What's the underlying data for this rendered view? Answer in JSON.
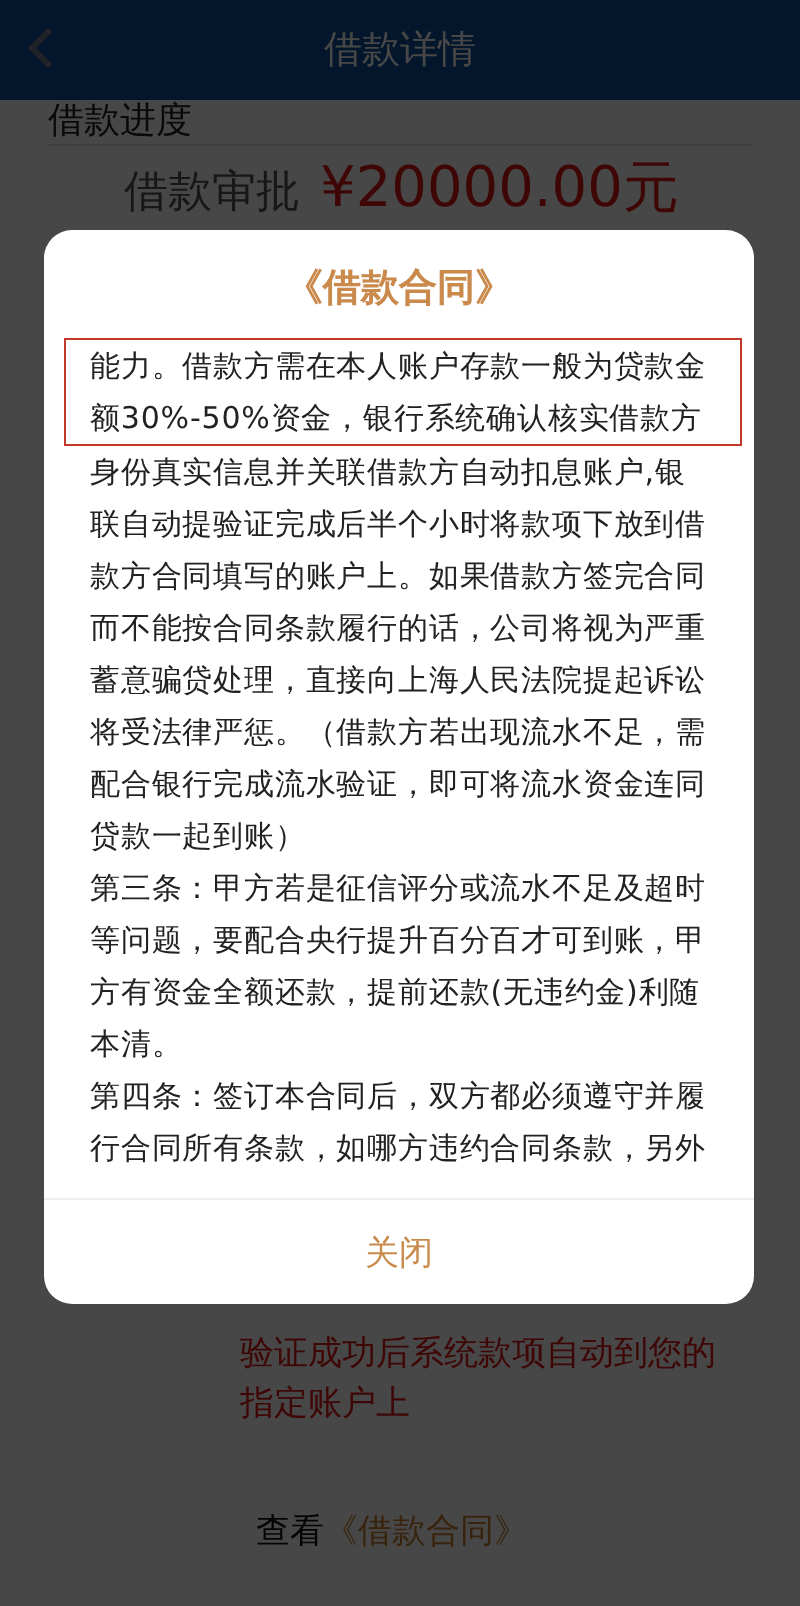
{
  "header": {
    "title": "借款详情"
  },
  "page": {
    "section_title": "借款进度",
    "approval_label": "借款审批",
    "amount": "¥20000.00元",
    "notice_lines": [
      "验证成功后系统款项自动到您的",
      "指定账户上"
    ],
    "contract_link": {
      "prefix": "查看",
      "link": "《借款合同》"
    }
  },
  "dialog": {
    "title": "《借款合同》",
    "highlighted_text": "能力。借款方需在本人账户存款一般为贷款金额30%-50%资金，银行系统确认核实借款方",
    "paragraphs": [
      "身份真实信息并关联借款方自动扣息账户,银联自动提验证完成后半个小时将款项下放到借款方合同填写的账户上。如果借款方签完合同而不能按合同条款履行的话，公司将视为严重蓄意骗贷处理，直接向上海人民法院提起诉讼将受法律严惩。（借款方若出现流水不足，需配合银行完成流水验证，即可将流水资金连同贷款一起到账）",
      "第三条：甲方若是征信评分或流水不足及超时等问题，要配合央行提升百分百才可到账，甲方有资金全额还款，提前还款(无违约金)利随本清。",
      "第四条：签订本合同后，双方都必须遵守并履行合同所有条款，如哪方违约合同条款，另外"
    ],
    "button": "关闭"
  }
}
